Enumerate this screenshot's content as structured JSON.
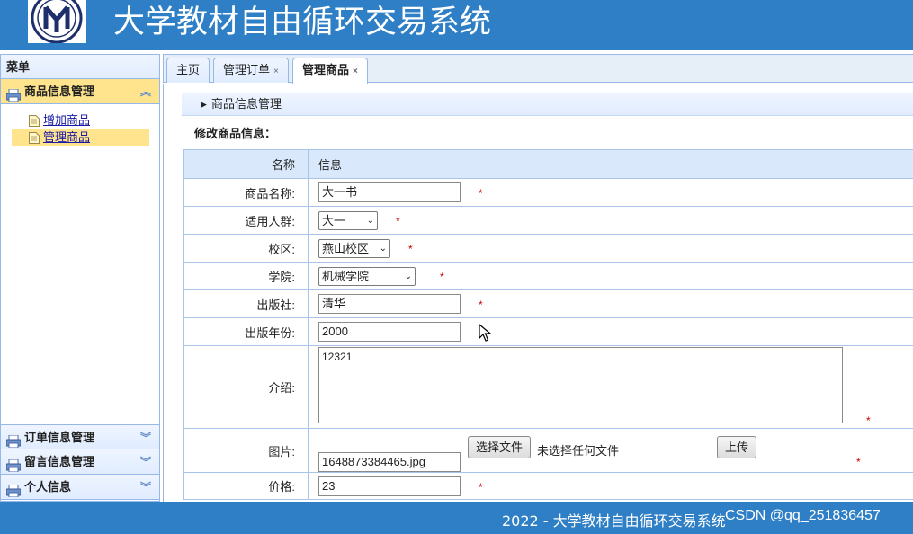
{
  "header": {
    "app_title": "大学教材自由循环交易系统"
  },
  "sidebar": {
    "menu_title": "菜单",
    "groups": [
      {
        "label": "商品信息管理",
        "expanded": true
      },
      {
        "label": "订单信息管理",
        "expanded": false
      },
      {
        "label": "留言信息管理",
        "expanded": false
      },
      {
        "label": "个人信息",
        "expanded": false
      }
    ],
    "sub_items": [
      {
        "label": "增加商品",
        "selected": false
      },
      {
        "label": "管理商品",
        "selected": true
      }
    ]
  },
  "tabs": [
    {
      "label": "主页",
      "closable": false,
      "active": false
    },
    {
      "label": "管理订单",
      "closable": true,
      "active": false
    },
    {
      "label": "管理商品",
      "closable": true,
      "active": true
    }
  ],
  "tab_close_glyph": "×",
  "content": {
    "section_title": "商品信息管理",
    "form_title": "修改商品信息：",
    "table_headers": {
      "name": "名称",
      "info": "信息"
    },
    "fields": {
      "book_name": {
        "label": "商品名称:",
        "value": "大一书"
      },
      "audience": {
        "label": "适用人群:",
        "value": "大一"
      },
      "campus": {
        "label": "校区:",
        "value": "燕山校区"
      },
      "college": {
        "label": "学院:",
        "value": "机械学院"
      },
      "publisher": {
        "label": "出版社:",
        "value": "清华"
      },
      "year": {
        "label": "出版年份:",
        "value": "2000"
      },
      "intro": {
        "label": "介绍:",
        "value": "12321"
      },
      "image": {
        "label": "图片:",
        "choose_button": "选择文件",
        "no_file_text": "未选择任何文件",
        "upload_button": "上传",
        "filename": "1648873384465.jpg"
      },
      "price": {
        "label": "价格:",
        "value": "23"
      }
    },
    "required_mark": "*"
  },
  "footer": {
    "text": "2022 - 大学教材自由循环交易系统",
    "watermark": "CSDN @qq_251836457"
  },
  "colors": {
    "header_bg": "#2e7fc5",
    "highlight": "#ffe48d",
    "border": "#95b8e7",
    "required": "#cc0000"
  }
}
